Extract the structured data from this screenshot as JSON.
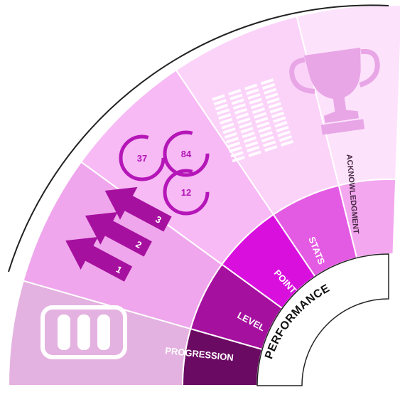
{
  "hub": {
    "label": "PERFORMANCE"
  },
  "segments": [
    {
      "label": "PROGRESSION",
      "inner_color": "#6b0a63",
      "outer_color": "#e4b2e0"
    },
    {
      "label": "LEVEL",
      "inner_color": "#a6109f",
      "outer_color": "#efa6ec"
    },
    {
      "label": "POINT",
      "inner_color": "#d910dd",
      "outer_color": "#f7baf5"
    },
    {
      "label": "STATS",
      "inner_color": "#e45be3",
      "outer_color": "#fbd3f9"
    },
    {
      "label": "ACKNOWLEDGMENT",
      "inner_color": "#f3a7ef",
      "outer_color": "#fde2fb"
    }
  ],
  "icons": {
    "progression": {
      "name": "progress-bars-icon"
    },
    "level": {
      "name": "level-arrows-icon",
      "numbers": [
        "1",
        "2",
        "3"
      ]
    },
    "point": {
      "name": "points-circles-icon",
      "numbers": [
        "37",
        "84",
        "12"
      ]
    },
    "stats": {
      "name": "stats-columns-icon"
    },
    "acknowledgment": {
      "name": "trophy-icon"
    }
  }
}
